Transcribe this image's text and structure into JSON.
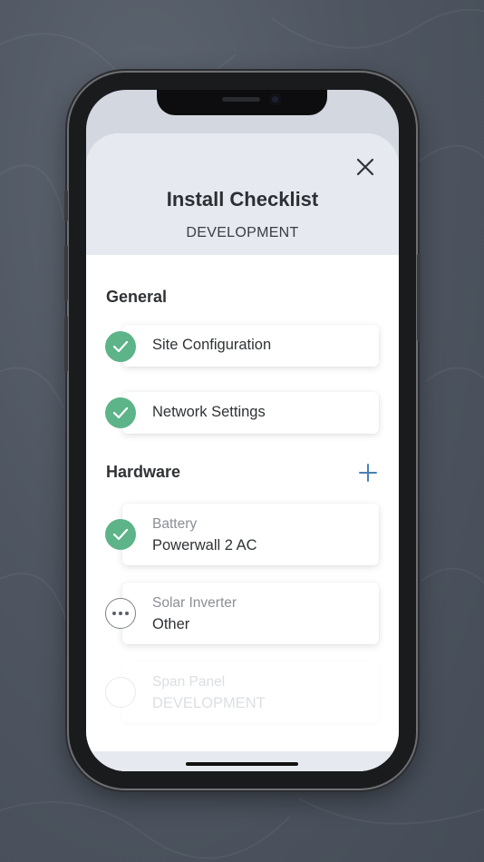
{
  "sheet": {
    "title": "Install Checklist",
    "subtitle": "DEVELOPMENT"
  },
  "sections": {
    "general": {
      "title": "General",
      "items": [
        {
          "label": "Site Configuration",
          "status": "complete"
        },
        {
          "label": "Network Settings",
          "status": "complete"
        }
      ]
    },
    "hardware": {
      "title": "Hardware",
      "items": [
        {
          "label": "Battery",
          "value": "Powerwall 2 AC",
          "status": "complete"
        },
        {
          "label": "Solar Inverter",
          "value": "Other",
          "status": "in-progress"
        },
        {
          "label": "Span Panel",
          "value": "DEVELOPMENT",
          "status": "disabled"
        }
      ]
    }
  },
  "icons": {
    "close": "close-icon",
    "add": "plus-icon",
    "complete": "checkmark-icon",
    "in_progress": "more-dots-icon"
  },
  "colors": {
    "complete_green": "#5cb488",
    "accent_blue": "#4a7fb5",
    "header_bg": "#e6eaf0"
  }
}
